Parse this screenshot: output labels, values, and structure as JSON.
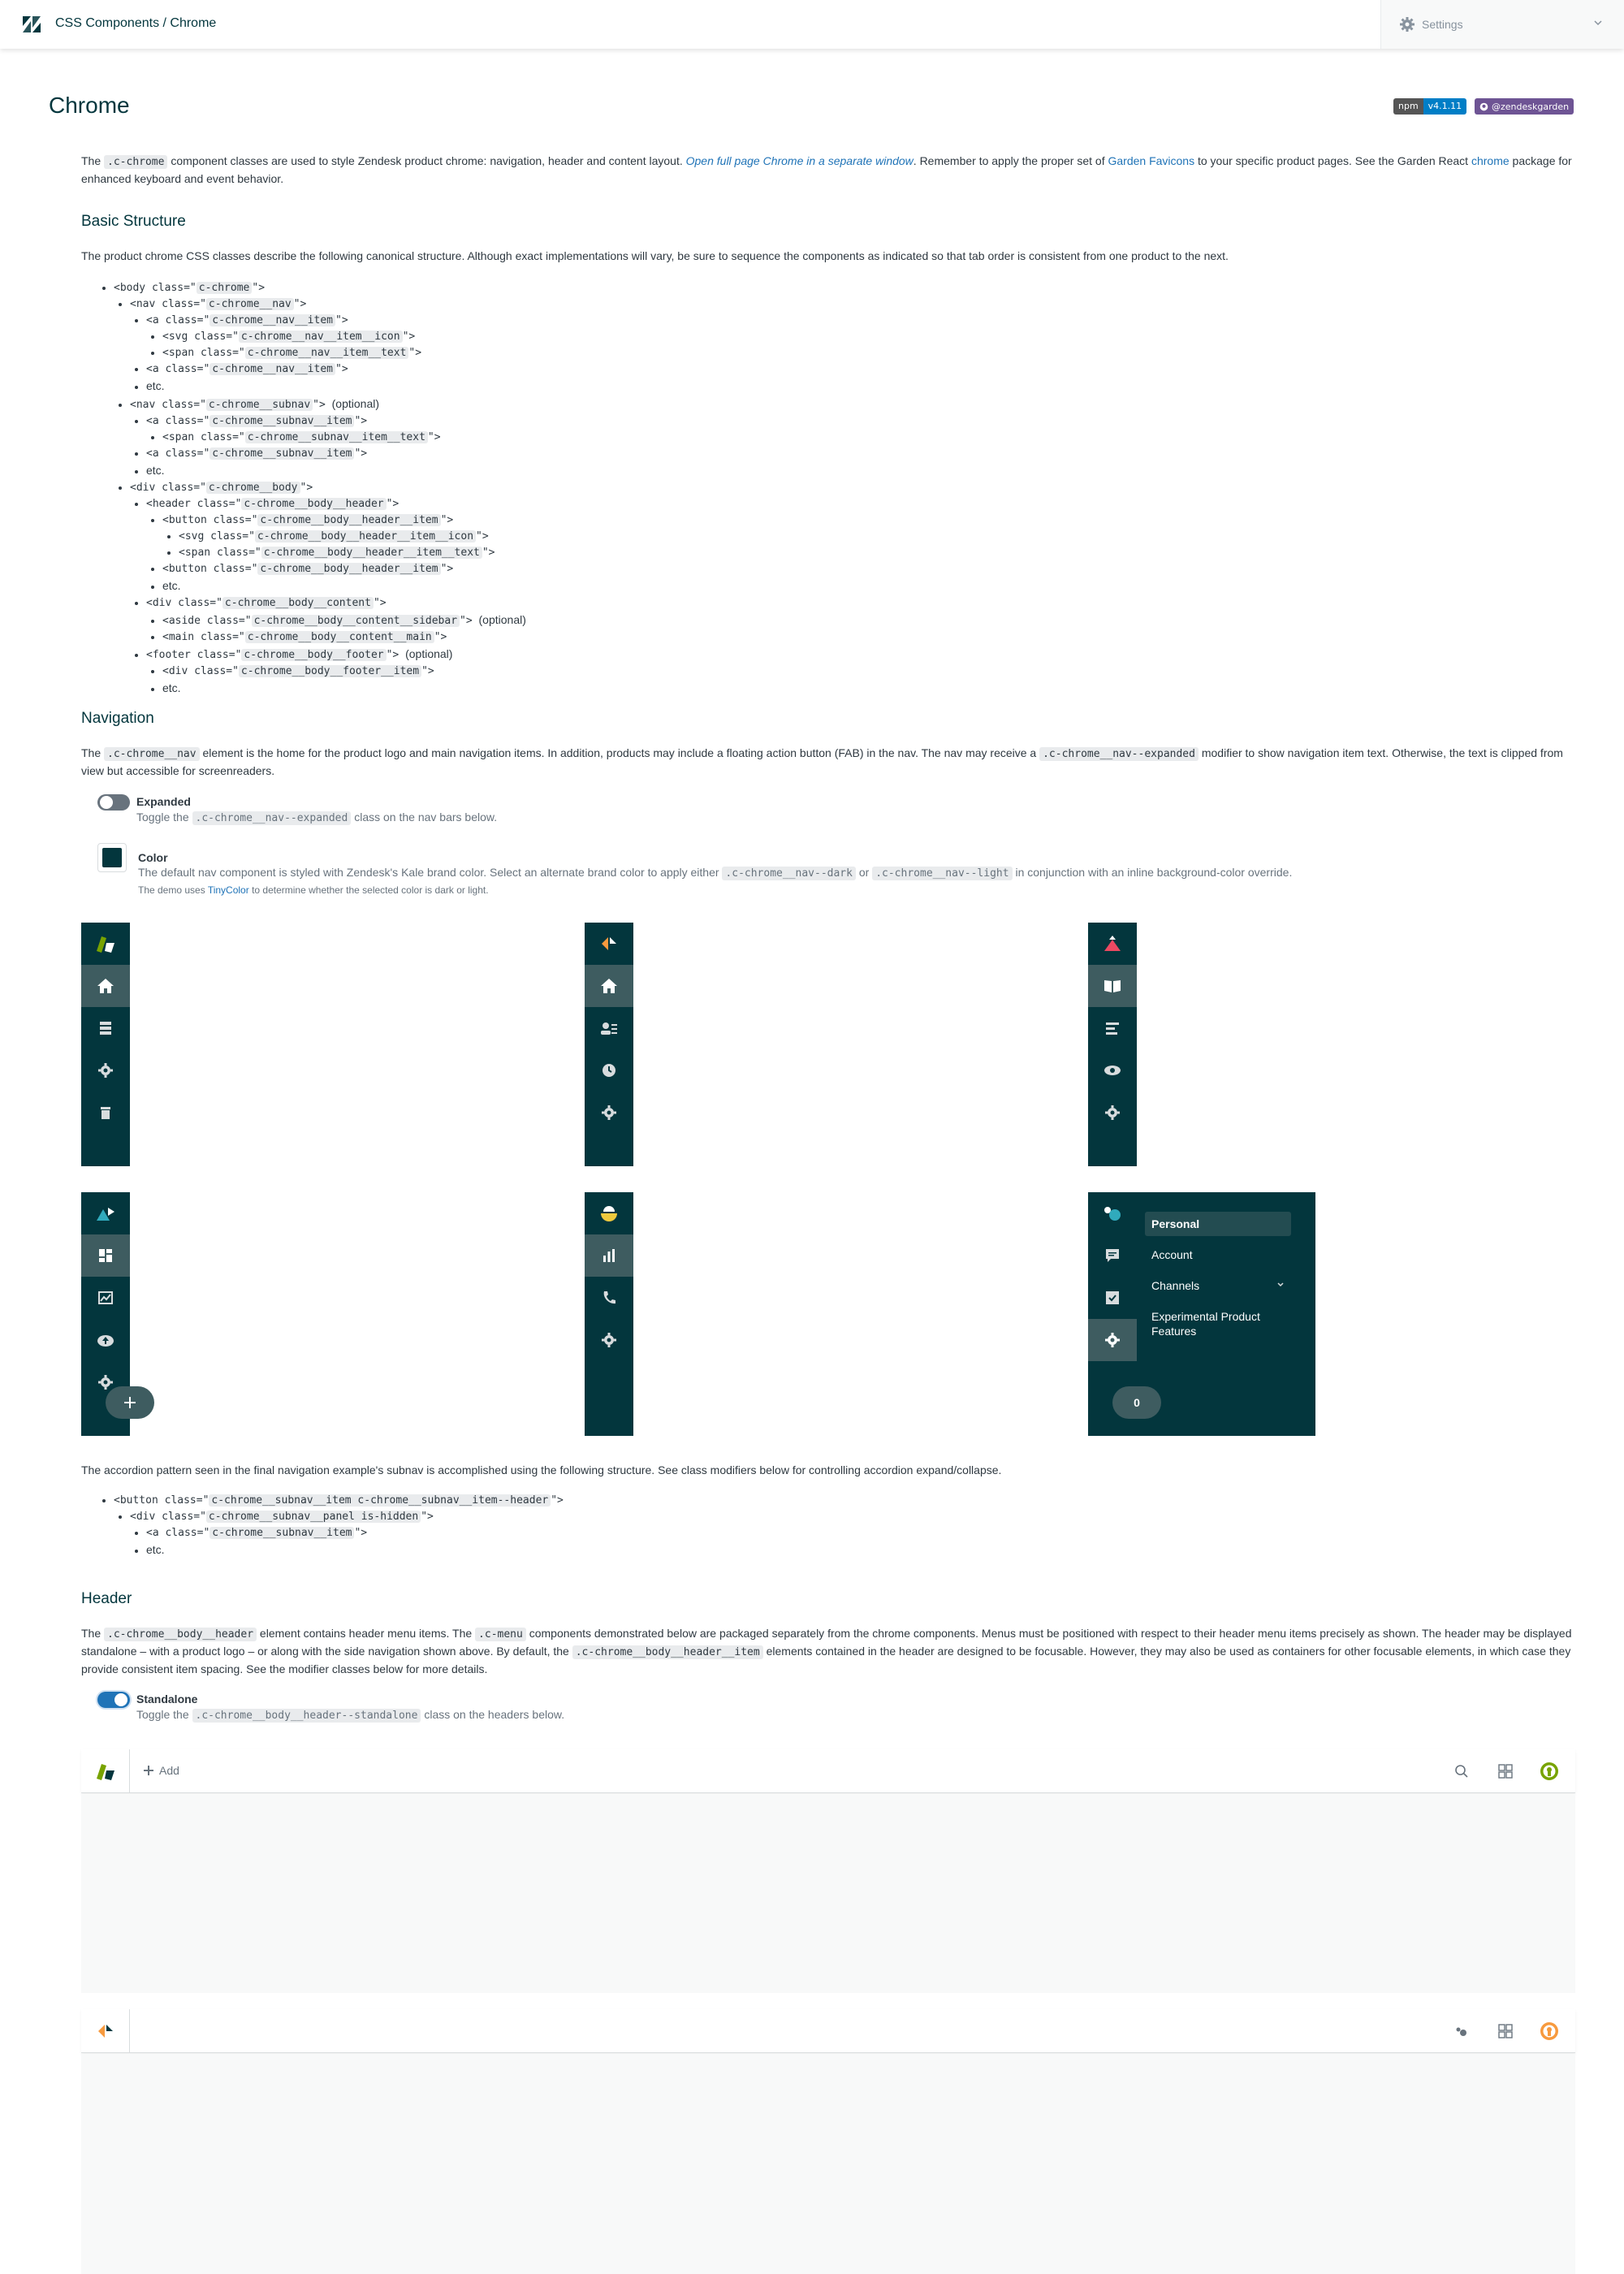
{
  "topbar": {
    "title": "CSS Components / Chrome",
    "settings_label": "Settings"
  },
  "page": {
    "title": "Chrome",
    "npm_label": "npm",
    "npm_version": "v4.1.11",
    "github_label": "@zendeskgarden"
  },
  "intro": {
    "t1": "The ",
    "code1": ".c-chrome",
    "t2": " component classes are used to style Zendesk product chrome: navigation, header and content layout. ",
    "link1": "Open full page Chrome in a separate window",
    "t3": ". Remember to apply the proper set of ",
    "link2": "Garden Favicons",
    "t4": " to your specific product pages. See the Garden React ",
    "link3": "chrome",
    "t5": " package for enhanced keyboard and event behavior."
  },
  "basic": {
    "heading": "Basic Structure",
    "text": "The product chrome CSS classes describe the following canonical structure. Although exact implementations will vary, be sure to sequence the components as indicated so that tab order is consistent from one product to the next."
  },
  "tree": {
    "optional": "(optional)",
    "etc": "etc.",
    "body_class": "c-chrome",
    "nav_class": "c-chrome__nav",
    "nav_item": "c-chrome__nav__item",
    "nav_item_icon": "c-chrome__nav__item__icon",
    "nav_item_text": "c-chrome__nav__item__text",
    "subnav": "c-chrome__subnav",
    "subnav_item": "c-chrome__subnav__item",
    "subnav_item_text": "c-chrome__subnav__item__text",
    "body": "c-chrome__body",
    "body_header": "c-chrome__body__header",
    "body_header_item": "c-chrome__body__header__item",
    "body_header_item_icon": "c-chrome__body__header__item__icon",
    "body_header_item_text": "c-chrome__body__header__item__text",
    "body_content": "c-chrome__body__content",
    "body_content_sidebar": "c-chrome__body__content__sidebar",
    "body_content_main": "c-chrome__body__content__main",
    "body_footer": "c-chrome__body__footer",
    "body_footer_item": "c-chrome__body__footer__item"
  },
  "navigation": {
    "heading": "Navigation",
    "t1": "The ",
    "code1": ".c-chrome__nav",
    "t2": " element is the home for the product logo and main navigation items. In addition, products may include a floating action button (FAB) in the nav. The nav may receive a ",
    "code2": ".c-chrome__nav--expanded",
    "t3": " modifier to show navigation item text. Otherwise, the text is clipped from view but accessible for screenreaders.",
    "expanded_label": "Expanded",
    "expanded_hint_1": "Toggle the ",
    "expanded_hint_code": ".c-chrome__nav--expanded",
    "expanded_hint_2": " class on the nav bars below.",
    "color_label": "Color",
    "color_hint_1": "The default nav component is styled with Zendesk's Kale brand color. Select an alternate brand color to apply either ",
    "color_code_dark": ".c-chrome__nav--dark",
    "color_hint_or": " or ",
    "color_code_light": ".c-chrome__nav--light",
    "color_hint_2": " in conjunction with an inline background-color override.",
    "color_small_1": "The demo uses ",
    "color_small_link": "TinyColor",
    "color_small_2": " to determine whether the selected color is dark or light.",
    "nav_color": "#03363d",
    "nav_current_color": "#3e5c60"
  },
  "subnav": {
    "items": [
      "Personal",
      "Account",
      "Channels",
      "Experimental Product Features"
    ],
    "fab_count": "0"
  },
  "accordion": {
    "text": "The accordion pattern seen in the final navigation example's subnav is accomplished using the following structure. See class modifiers below for controlling accordion expand/collapse.",
    "button_class": "c-chrome__subnav__item c-chrome__subnav__item--header",
    "panel_class": "c-chrome__subnav__panel is-hidden",
    "item_class": "c-chrome__subnav__item",
    "etc": "etc."
  },
  "header": {
    "heading": "Header",
    "t1": "The ",
    "code1": ".c-chrome__body__header",
    "t2": " element contains header menu items. The ",
    "code2": ".c-menu",
    "t3": " components demonstrated below are packaged separately from the chrome components. Menus must be positioned with respect to their header menu items precisely as shown. The header may be displayed standalone – with a product logo – or along with the side navigation shown above. By default, the ",
    "code3": ".c-chrome__body__header__item",
    "t4": " elements contained in the header are designed to be focusable. However, they may also be used as containers for other focusable elements, in which case they provide consistent item spacing. See the modifier classes below for more details.",
    "standalone_label": "Standalone",
    "standalone_hint_1": "Toggle the ",
    "standalone_hint_code": ".c-chrome__body__header--standalone",
    "standalone_hint_2": " class on the headers below.",
    "add_label": "Add"
  }
}
